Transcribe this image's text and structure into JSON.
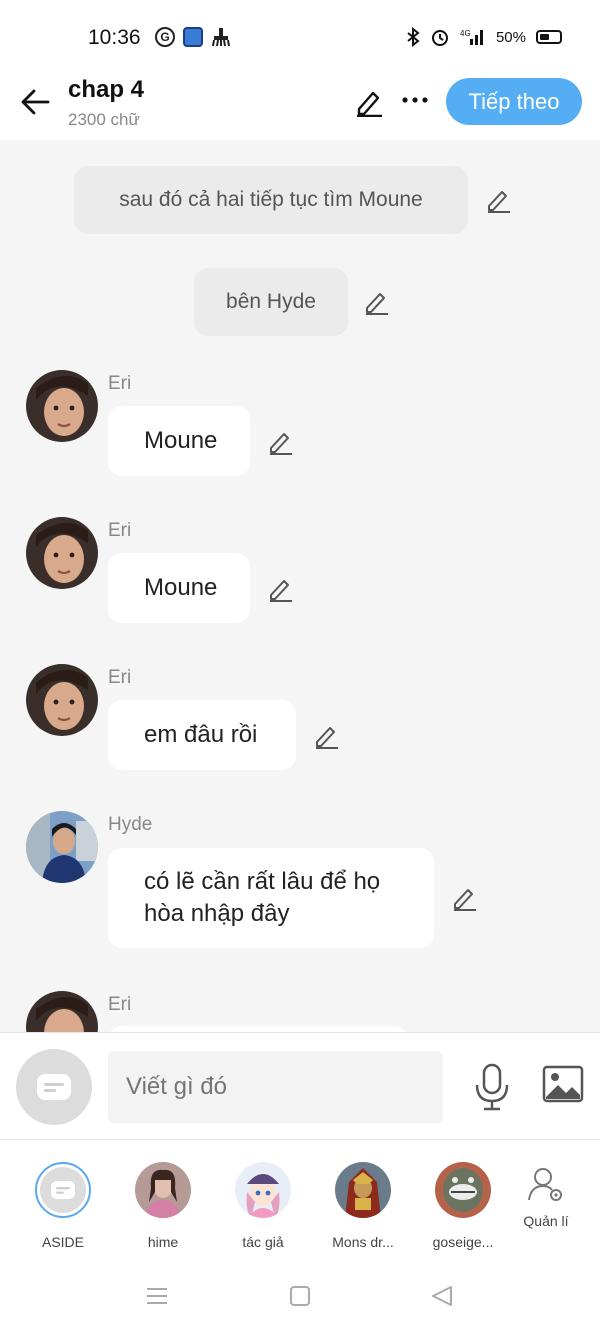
{
  "status_bar": {
    "time": "10:36",
    "battery": "50%",
    "network": "4G"
  },
  "header": {
    "title": "chap 4",
    "subtitle": "2300 chữ",
    "next_label": "Tiếp theo",
    "accent_color": "#55aef4"
  },
  "messages": [
    {
      "type": "narration",
      "text": "sau đó cả hai tiếp tục tìm Moune"
    },
    {
      "type": "narration",
      "text": "bên Hyde"
    },
    {
      "type": "character",
      "name": "Eri",
      "text": "Moune"
    },
    {
      "type": "character",
      "name": "Eri",
      "text": "Moune"
    },
    {
      "type": "character",
      "name": "Eri",
      "text": "em đâu rồi"
    },
    {
      "type": "character",
      "name": "Hyde",
      "text": "có lẽ cần rất lâu để họ hòa nhập đây"
    },
    {
      "type": "character",
      "name": "Eri",
      "text": ""
    }
  ],
  "input": {
    "placeholder": "Viết gì đó"
  },
  "characters": [
    {
      "label": "ASIDE",
      "selected": true
    },
    {
      "label": "hime"
    },
    {
      "label": "tác giả"
    },
    {
      "label": "Mons dr..."
    },
    {
      "label": "goseige..."
    },
    {
      "label": "Quản lí",
      "icon": "manage-icon"
    }
  ]
}
